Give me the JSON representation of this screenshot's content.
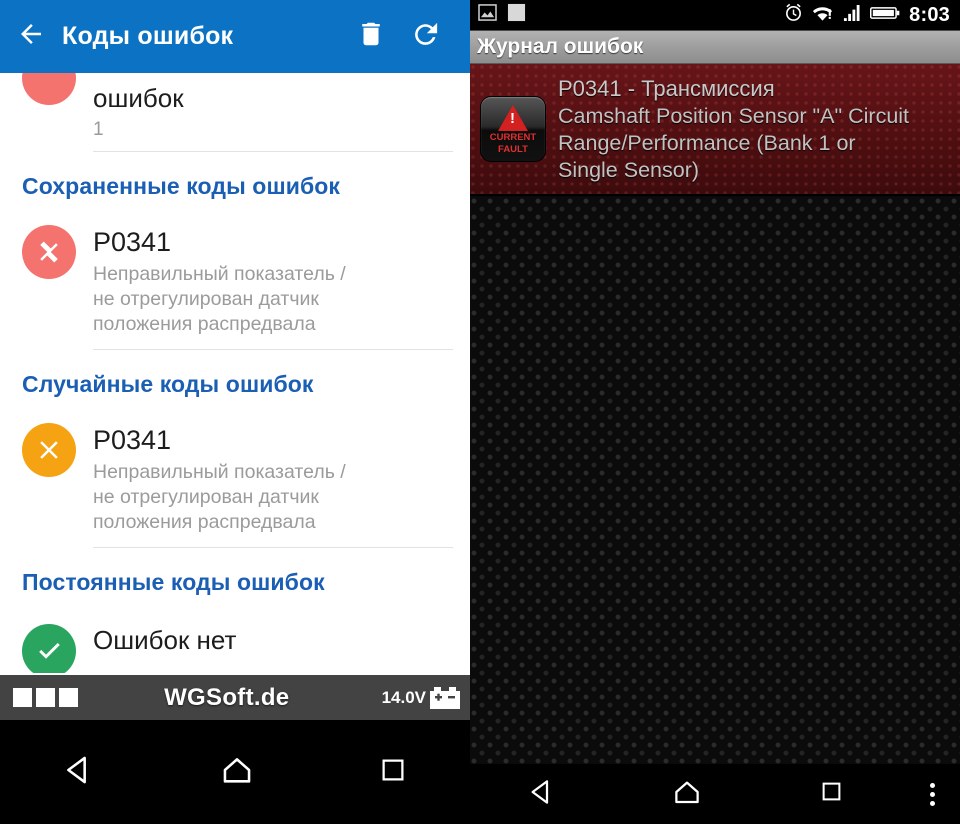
{
  "left_phone": {
    "appbar": {
      "back_icon": "arrow-back-icon",
      "title": "Коды ошибок",
      "delete_icon": "trash-icon",
      "refresh_icon": "refresh-icon"
    },
    "partial_row": {
      "title": "ошибок",
      "value": "1"
    },
    "sections": [
      {
        "heading": "Сохраненные коды ошибок",
        "rows": [
          {
            "status": "red",
            "code": "P0341",
            "description": "Неправильный показатель /\nне отрегулирован датчик\nположения распредвала"
          }
        ]
      },
      {
        "heading": "Случайные коды ошибок",
        "rows": [
          {
            "status": "orange",
            "code": "P0341",
            "description": "Неправильный показатель /\nне отрегулирован датчик\nположения распредвала"
          }
        ]
      },
      {
        "heading": "Постоянные коды ошибок",
        "rows": [
          {
            "status": "green",
            "code": "Ошибок нет",
            "description": ""
          }
        ]
      }
    ],
    "status_strip": {
      "blocks_icon": "signal-blocks-icon",
      "brand": "WGSoft.de",
      "voltage": "14.0V",
      "battery_icon": "car-battery-icon"
    },
    "navbar": {
      "back_icon": "nav-back-triangle-icon",
      "home_icon": "nav-home-icon",
      "recents_icon": "nav-recents-square-icon"
    }
  },
  "right_phone": {
    "statusbar": {
      "image_icon": "gallery-image-icon",
      "placeholder_icon": "app-notification-icon",
      "alarm_icon": "alarm-clock-icon",
      "wifi_icon": "wifi-warning-icon",
      "signal_icon": "cell-signal-icon",
      "battery_icon": "battery-icon",
      "clock": "8:03"
    },
    "title_bar": {
      "title": "Журнал ошибок"
    },
    "fault": {
      "badge_icon": "warning-triangle-icon",
      "badge_line1": "CURRENT",
      "badge_line2": "FAULT",
      "code_line": "P0341 - Трансмиссия",
      "description": "Camshaft Position Sensor \"A\" Circuit\nRange/Performance (Bank 1 or\nSingle Sensor)"
    },
    "navbar": {
      "back_icon": "nav-back-triangle-icon",
      "home_icon": "nav-home-icon",
      "recents_icon": "nav-recents-square-icon",
      "overflow_icon": "overflow-menu-icon"
    }
  },
  "colors": {
    "appbar_blue": "#0c72c4",
    "section_heading_blue": "#1b5fb4",
    "status_red": "#f4736f",
    "status_orange": "#f6a313",
    "status_green": "#2aa560",
    "fault_red_bg": "#5d1315"
  }
}
